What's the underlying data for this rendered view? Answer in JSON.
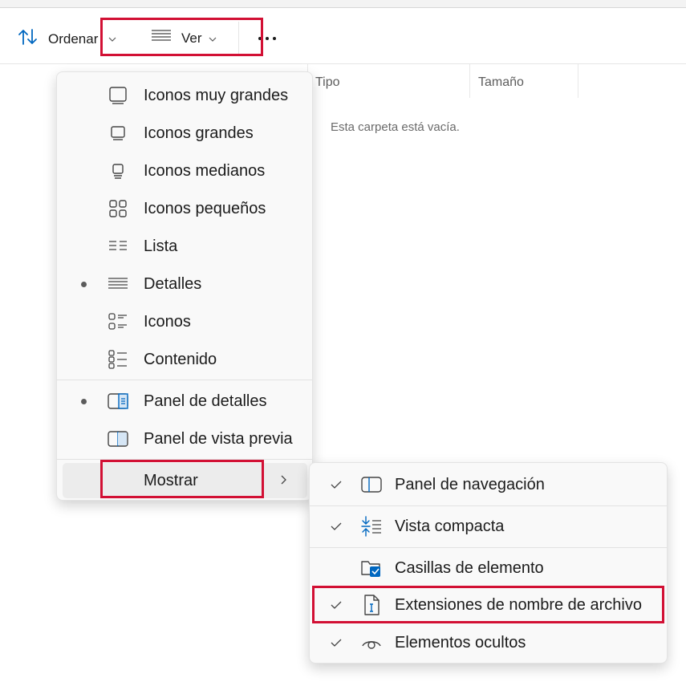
{
  "toolbar": {
    "sort_label": "Ordenar",
    "view_label": "Ver"
  },
  "columns": {
    "type_label": "Tipo",
    "size_label": "Tamaño"
  },
  "content": {
    "empty_message": "Esta carpeta está vacía."
  },
  "view_menu": {
    "items": [
      {
        "label": "Iconos muy grandes",
        "icon": "extra-large-icons-icon",
        "selected": false
      },
      {
        "label": "Iconos grandes",
        "icon": "large-icons-icon",
        "selected": false
      },
      {
        "label": "Iconos medianos",
        "icon": "medium-icons-icon",
        "selected": false
      },
      {
        "label": "Iconos pequeños",
        "icon": "small-icons-icon",
        "selected": false
      },
      {
        "label": "Lista",
        "icon": "list-icon",
        "selected": false
      },
      {
        "label": "Detalles",
        "icon": "details-icon",
        "selected": true
      },
      {
        "label": "Iconos",
        "icon": "tiles-icon",
        "selected": false
      },
      {
        "label": "Contenido",
        "icon": "content-icon",
        "selected": false
      }
    ],
    "panes": [
      {
        "label": "Panel de detalles",
        "icon": "details-pane-icon",
        "selected": true
      },
      {
        "label": "Panel de vista previa",
        "icon": "preview-pane-icon",
        "selected": false
      }
    ],
    "show_label": "Mostrar"
  },
  "show_submenu": {
    "items": [
      {
        "label": "Panel de navegación",
        "icon": "navigation-pane-icon",
        "checked": true
      },
      {
        "label": "Vista compacta",
        "icon": "compact-view-icon",
        "checked": true
      },
      {
        "label": "Casillas de elemento",
        "icon": "item-checkboxes-icon",
        "checked": false
      },
      {
        "label": "Extensiones de nombre de archivo",
        "icon": "file-extension-icon",
        "checked": true
      },
      {
        "label": "Elementos ocultos",
        "icon": "hidden-items-icon",
        "checked": true
      }
    ]
  },
  "colors": {
    "accent": "#0067c0",
    "highlight_border": "#d21034",
    "menu_background": "#f9f9f9"
  }
}
